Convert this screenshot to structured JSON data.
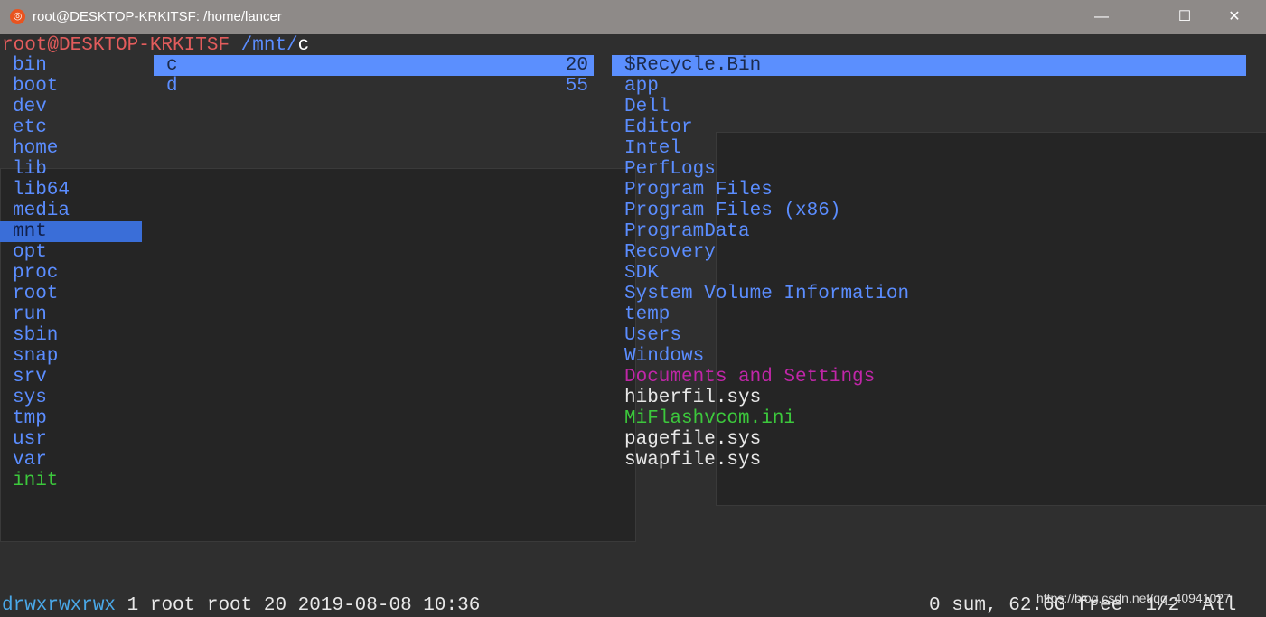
{
  "window": {
    "title": "root@DESKTOP-KRKITSF: /home/lancer",
    "minimize": "—",
    "maximize": "☐",
    "close": "✕"
  },
  "prompt": {
    "user_host": "root@DESKTOP-KRKITSF",
    "path": " /mnt/",
    "current": "c"
  },
  "left_column": [
    "bin",
    "boot",
    "dev",
    "etc",
    "home",
    "lib",
    "lib64",
    "media",
    "mnt",
    "opt",
    "proc",
    "root",
    "run",
    "sbin",
    "snap",
    "srv",
    "sys",
    "tmp",
    "usr",
    "var",
    "init"
  ],
  "left_selected": "mnt",
  "middle_column": [
    {
      "name": "c",
      "size": "20"
    },
    {
      "name": "d",
      "size": "55"
    }
  ],
  "right_column": [
    {
      "name": "$Recycle.Bin",
      "type": "dir"
    },
    {
      "name": "app",
      "type": "dir"
    },
    {
      "name": "Dell",
      "type": "dir"
    },
    {
      "name": "Editor",
      "type": "dir"
    },
    {
      "name": "Intel",
      "type": "dir"
    },
    {
      "name": "PerfLogs",
      "type": "dir"
    },
    {
      "name": "Program Files",
      "type": "dir"
    },
    {
      "name": "Program Files (x86)",
      "type": "dir"
    },
    {
      "name": "ProgramData",
      "type": "dir"
    },
    {
      "name": "Recovery",
      "type": "dir"
    },
    {
      "name": "SDK",
      "type": "dir"
    },
    {
      "name": "System Volume Information",
      "type": "dir"
    },
    {
      "name": "temp",
      "type": "dir"
    },
    {
      "name": "Users",
      "type": "dir"
    },
    {
      "name": "Windows",
      "type": "dir"
    },
    {
      "name": "Documents and Settings",
      "type": "link"
    },
    {
      "name": "hiberfil.sys",
      "type": "file"
    },
    {
      "name": "MiFlashvcom.ini",
      "type": "exec"
    },
    {
      "name": "pagefile.sys",
      "type": "file"
    },
    {
      "name": "swapfile.sys",
      "type": "file"
    }
  ],
  "status": {
    "perms": "drwxrwxrwx",
    "info": " 1 root root 20 2019-08-08 10:36",
    "right": "0 sum, 62.6G free  1/2  All"
  },
  "watermark": "https://blog.csdn.net/qq_40941027",
  "colors": {
    "dir": "#5b8dff",
    "link": "#c026a8",
    "exec": "#3cc83c",
    "file": "#e8e8e8",
    "prompt": "#e25c5c",
    "selection": "#5b8ffe"
  }
}
